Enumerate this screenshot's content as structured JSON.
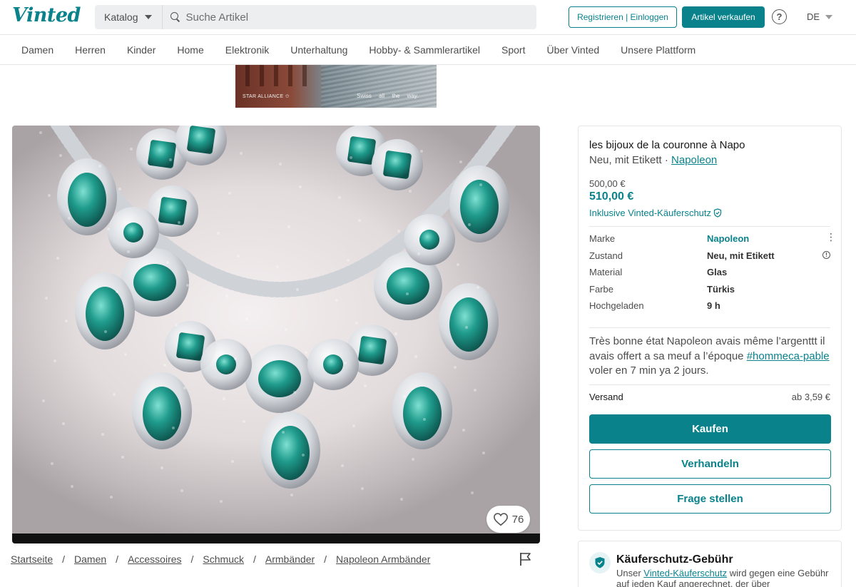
{
  "header": {
    "logo": "Vinted",
    "catalog_label": "Katalog",
    "search_placeholder": "Suche Artikel",
    "register_label": "Registrieren | Einloggen",
    "sell_label": "Artikel verkaufen",
    "help_symbol": "?",
    "language": "DE"
  },
  "nav": {
    "items": [
      "Damen",
      "Herren",
      "Kinder",
      "Home",
      "Elektronik",
      "Unterhaltung",
      "Hobby- & Sammlerartikel",
      "Sport",
      "Über Vinted",
      "Unsere Plattform"
    ]
  },
  "ad": {
    "brand": "STAR ALLIANCE ✩",
    "slogan": "Swiss all the way."
  },
  "photo": {
    "likes": "76"
  },
  "breadcrumb": [
    "Startseite",
    "Damen",
    "Accessoires",
    "Schmuck",
    "Armbänder",
    "Napoleon Armbänder"
  ],
  "item": {
    "title": "les bijoux de la couronne à Napo",
    "condition_text": "Neu, mit Etikett · ",
    "brand_link": "Napoleon",
    "price_original": "500,00 €",
    "price_total": "510,00 €",
    "protection": "Inklusive Vinted-Käuferschutz",
    "details": [
      {
        "key": "Marke",
        "value": "Napoleon"
      },
      {
        "key": "Zustand",
        "value": "Neu, mit Etikett"
      },
      {
        "key": "Material",
        "value": "Glas"
      },
      {
        "key": "Farbe",
        "value": "Türkis"
      },
      {
        "key": "Hochgeladen",
        "value": "9 h"
      }
    ],
    "description_a": "Très bonne état Napoleon avais même l’argenttt il avais offert a sa meuf a l’époque ",
    "description_tag": "#hommeca-pable",
    "description_b": " voler en 7 min ya 2 jours.",
    "shipping_label": "Versand",
    "shipping_value": "ab 3,59 €",
    "buy_label": "Kaufen",
    "negotiate_label": "Verhandeln",
    "ask_label": "Frage stellen"
  },
  "fee": {
    "title": "Käuferschutz-Gebühr",
    "text_a": "Unser ",
    "link": "Vinted-Käuferschutz",
    "text_b": " wird gegen eine Gebühr auf jeden Kauf angerechnet, der über"
  },
  "colors": {
    "brand": "#09828c",
    "text": "#171717",
    "muted": "#4d4d4d"
  }
}
